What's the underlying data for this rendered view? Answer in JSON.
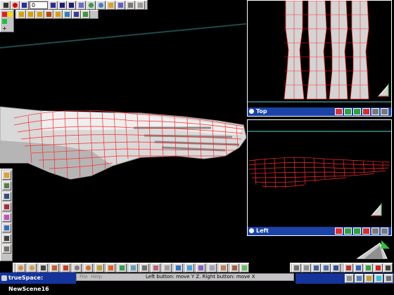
{
  "app": {
    "title": "trueSpace: NewScene16"
  },
  "toolbar": {
    "frame_value": "0"
  },
  "menu": {
    "file_label": "File",
    "help_label": "Help"
  },
  "status": {
    "hint": "Left button: move Y Z. Right button: move X"
  },
  "viewports": {
    "top": {
      "label": "Top"
    },
    "left": {
      "label": "Left"
    }
  },
  "colors": {
    "wire": "#ff2a2a",
    "title_bar": "#1a43a8",
    "panel": "#c6c3c6",
    "guide": "#1e4a4a"
  }
}
